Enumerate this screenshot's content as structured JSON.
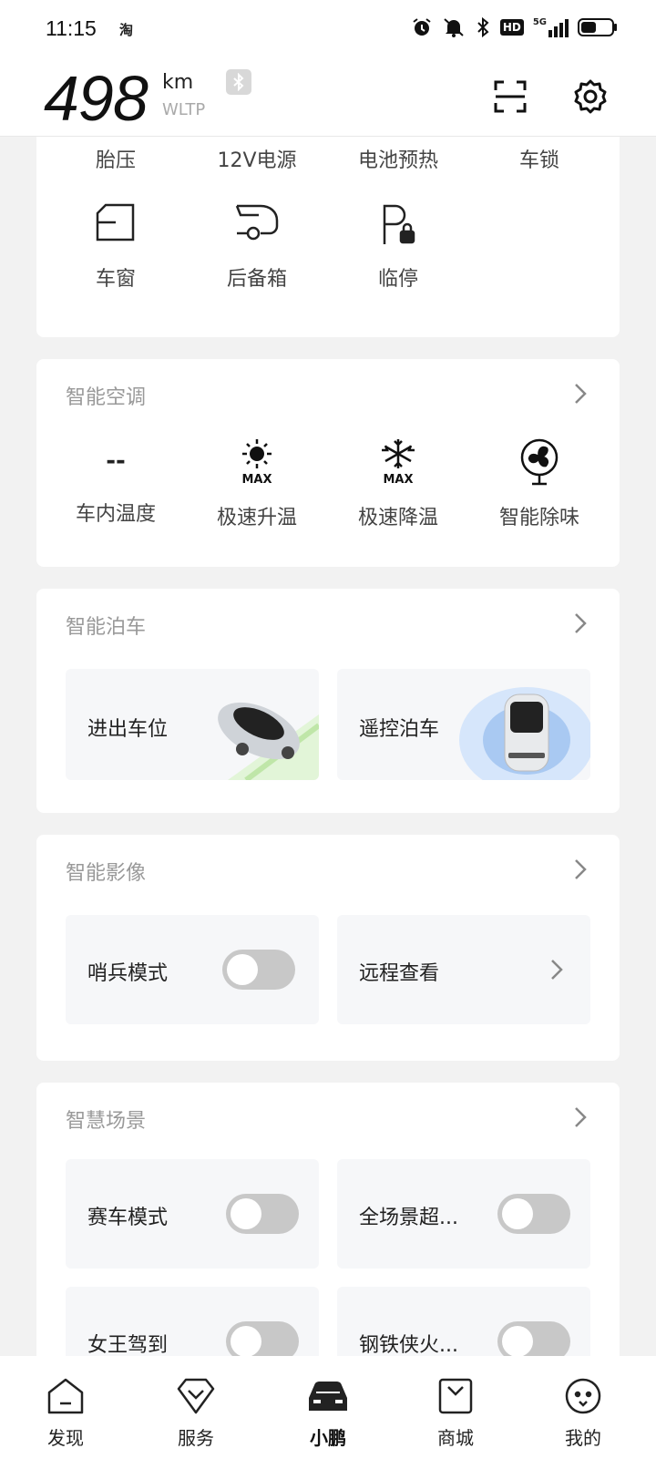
{
  "status_bar": {
    "time": "11:15",
    "app_icon_text": "淘",
    "icons": [
      "alarm-icon",
      "mute-icon",
      "bluetooth-icon",
      "hd-icon",
      "5g-signal-icon",
      "battery-icon"
    ],
    "hd": "HD",
    "network": "5G"
  },
  "header": {
    "range_value": "498",
    "range_unit": "km",
    "range_standard": "WLTP"
  },
  "quick_controls": {
    "top_row": [
      "胎压",
      "12V电源",
      "电池预热",
      "车锁"
    ],
    "bottom_row": [
      {
        "label": "车窗",
        "icon": "window-icon"
      },
      {
        "label": "后备箱",
        "icon": "trunk-icon"
      },
      {
        "label": "临停",
        "icon": "temp-parking-icon"
      }
    ]
  },
  "climate": {
    "title": "智能空调",
    "items": [
      {
        "value": "--",
        "label": "车内温度",
        "icon": null
      },
      {
        "label": "极速升温",
        "icon": "sun-max-icon",
        "badge": "MAX"
      },
      {
        "label": "极速降温",
        "icon": "snowflake-max-icon",
        "badge": "MAX"
      },
      {
        "label": "智能除味",
        "icon": "fan-icon"
      }
    ]
  },
  "parking": {
    "title": "智能泊车",
    "tiles": [
      {
        "label": "进出车位"
      },
      {
        "label": "遥控泊车"
      }
    ]
  },
  "camera": {
    "title": "智能影像",
    "sentry": {
      "label": "哨兵模式",
      "on": false
    },
    "remote_view": {
      "label": "远程查看"
    }
  },
  "scenes": {
    "title": "智慧场景",
    "items": [
      {
        "label": "赛车模式",
        "on": false
      },
      {
        "label": "全场景超...",
        "on": false
      },
      {
        "label": "女王驾到",
        "on": false
      },
      {
        "label": "钢铁侠火...",
        "on": false
      }
    ]
  },
  "tabbar": {
    "tabs": [
      {
        "label": "发现",
        "icon": "home-icon"
      },
      {
        "label": "服务",
        "icon": "service-icon"
      },
      {
        "label": "小鹏",
        "icon": "car-icon",
        "active": true
      },
      {
        "label": "商城",
        "icon": "shop-icon"
      },
      {
        "label": "我的",
        "icon": "profile-icon"
      }
    ]
  }
}
